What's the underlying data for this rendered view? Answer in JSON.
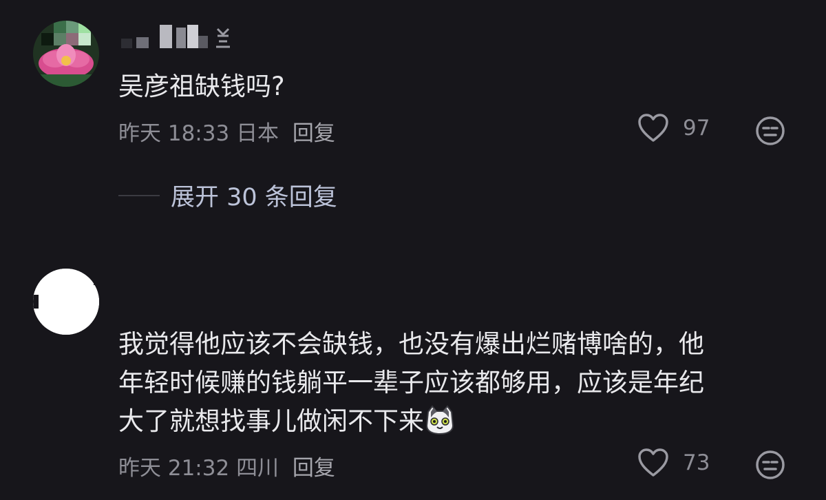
{
  "comments": [
    {
      "username": "",
      "text": "吴彦祖缺钱吗?",
      "time": "昨天 18:33",
      "location": "日本",
      "reply_label": "回复",
      "likes": "97",
      "expand_label": "展开 30 条回复"
    },
    {
      "username": "",
      "text_lines": [
        "我觉得他应该不会缺钱，也没有爆出烂赌博啥的，他",
        "年轻时候赚的钱躺平一辈子应该都够用，应该是年纪",
        "大了就想找事儿做闲不下来"
      ],
      "time": "昨天 21:32",
      "location": "四川",
      "reply_label": "回复",
      "likes": "73"
    }
  ],
  "icons": {
    "like": "heart-outline-icon",
    "emoji": "neutral-face-icon",
    "inline_emoji": "cat-face-emoji"
  },
  "colors": {
    "background": "#17161b",
    "text": "#e9e9ec",
    "meta": "#8e8e96",
    "expand": "#bcc3d9"
  }
}
